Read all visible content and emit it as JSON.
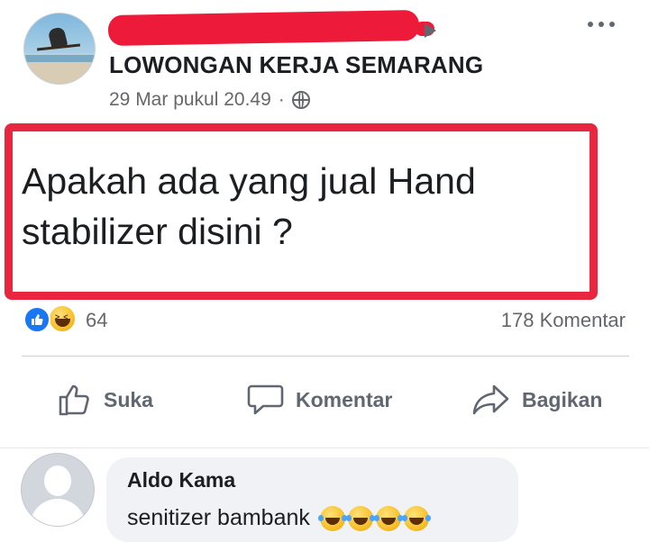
{
  "post": {
    "group_name": "LOWONGAN KERJA SEMARANG",
    "timestamp": "29 Mar pukul 20.49",
    "separator": "·",
    "privacy_icon": "globe-icon",
    "text": "Apakah ada yang jual Hand stabilizer disini ?",
    "highlight_color": "#e8263f",
    "redaction_color": "#ee1a3a"
  },
  "reactions": {
    "icons": [
      "like-icon",
      "haha-icon"
    ],
    "count": "64",
    "comments": "178 Komentar"
  },
  "actions": {
    "like_label": "Suka",
    "comment_label": "Komentar",
    "share_label": "Bagikan"
  },
  "comment": {
    "author": "Aldo Kama",
    "text": "senitizer bambank",
    "emoji_count": 4,
    "emoji_icon": "tears-of-joy-icon"
  },
  "colors": {
    "accent_blue": "#1877f2",
    "muted_text": "#65676b"
  }
}
